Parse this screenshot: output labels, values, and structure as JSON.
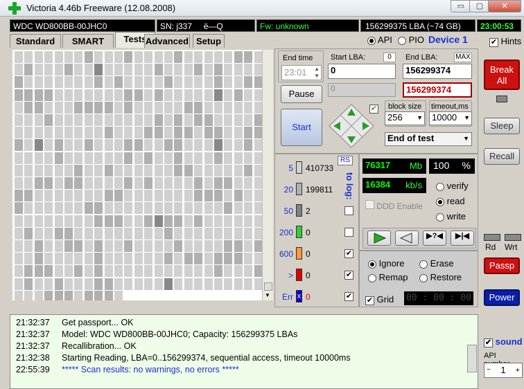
{
  "window": {
    "title": "Victoria 4.46b Freeware (12.08.2008)",
    "minimize": "▭",
    "maximize": "▢",
    "close": "✕"
  },
  "infobar": {
    "model": "WDC WD800BB-00JHC0",
    "serial": "SN: j337",
    "serial_extra": "ё—Q",
    "firmware": "Fw: unknown",
    "lba": "156299375 LBA (~74 GB)",
    "clock": "23:00:53"
  },
  "tabs": [
    "Standard",
    "SMART",
    "Tests",
    "Advanced",
    "Setup"
  ],
  "mode": {
    "api": "API",
    "pio": "PIO",
    "device": "Device 1",
    "hints": "Hints"
  },
  "test": {
    "end_time_label": "End time",
    "end_time": "23:01",
    "start_lba_label": "Start LBA:",
    "start_lba_small": "0",
    "start_lba": "0",
    "end_lba_label": "End LBA:",
    "max_label": "MAX",
    "end_lba": "156299374",
    "end_lba2": "156299374",
    "pause": "Pause",
    "start": "Start",
    "current": "0",
    "block_size_label": "block size",
    "block_size": "256",
    "timeout_label": "timeout,ms",
    "timeout": "10000",
    "end_of_test": "End of test"
  },
  "counters": {
    "rs": "RS",
    "to_log": "to log:",
    "rows": [
      {
        "ms": "5",
        "count": "410733",
        "color": "#d0d0d0"
      },
      {
        "ms": "20",
        "count": "199811",
        "color": "#b0b0b0"
      },
      {
        "ms": "50",
        "count": "2",
        "color": "#808080"
      },
      {
        "ms": "200",
        "count": "0",
        "color": "#33cc33"
      },
      {
        "ms": "600",
        "count": "0",
        "color": "#ff9933"
      },
      {
        "ms": ">",
        "count": "0",
        "color": "#e00000"
      },
      {
        "ms": "Err",
        "count": "0",
        "color": "#0000cc"
      }
    ]
  },
  "speed": {
    "mb": "76317",
    "mb_unit": "Mb",
    "percent": "100",
    "pct_unit": "%",
    "kbs": "16384",
    "kbs_unit": "kb/s",
    "ddd": "DDD Enable",
    "verify": "verify",
    "read": "read",
    "write": "write"
  },
  "actions": {
    "ignore": "Ignore",
    "erase": "Erase",
    "remap": "Remap",
    "restore": "Restore",
    "grid": "Grid",
    "timer": "00 : 00 : 00"
  },
  "side": {
    "break": "Break\nAll",
    "sleep": "Sleep",
    "recall": "Recall",
    "rd": "Rd",
    "wrt": "Wrt",
    "passp": "Passp",
    "power": "Power",
    "sound": "sound",
    "api_number": "API number",
    "api_value": "1"
  },
  "log": [
    {
      "time": "21:32:37",
      "text": "Get passport... OK",
      "color": "#000"
    },
    {
      "time": "21:32:37",
      "text": "Model: WDC WD800BB-00JHC0; Capacity: 156299375 LBAs",
      "color": "#000"
    },
    {
      "time": "21:32:37",
      "text": "Recallibration... OK",
      "color": "#000"
    },
    {
      "time": "21:32:38",
      "text": "Starting Reading, LBA=0..156299374, sequential access, timeout 10000ms",
      "color": "#000"
    },
    {
      "time": "22:55:39",
      "text": "***** Scan results: no warnings, no errors *****",
      "color": "#1a2fd0"
    }
  ]
}
